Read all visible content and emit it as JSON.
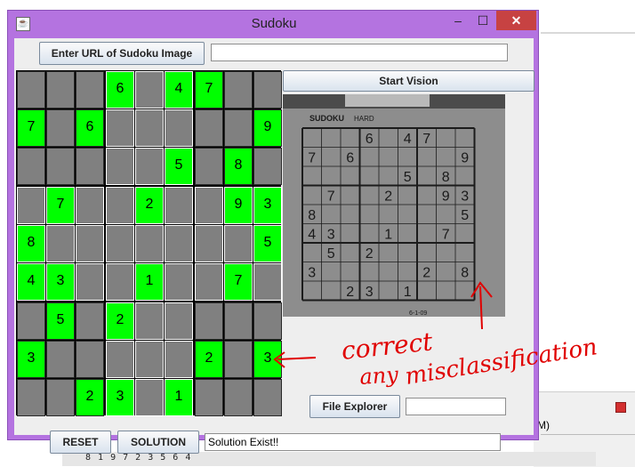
{
  "window": {
    "title": "Sudoku",
    "minimize": "–",
    "maximize": "☐",
    "close": "✕"
  },
  "toolbar": {
    "url_button": "Enter URL of Sudoku Image",
    "url_value": "",
    "start_vision": "Start Vision",
    "file_explorer": "File Explorer",
    "file_path": ""
  },
  "bottom": {
    "reset": "RESET",
    "solution": "SOLUTION",
    "status": "Solution Exist!!"
  },
  "grid": [
    [
      "",
      "",
      "",
      "6",
      "",
      "4",
      "7",
      "",
      ""
    ],
    [
      "7",
      "",
      "6",
      "",
      "",
      "",
      "",
      "",
      "9"
    ],
    [
      "",
      "",
      "",
      "",
      "",
      "5",
      "",
      "8",
      ""
    ],
    [
      "",
      "7",
      "",
      "",
      "2",
      "",
      "",
      "9",
      "3"
    ],
    [
      "8",
      "",
      "",
      "",
      "",
      "",
      "",
      "",
      "5"
    ],
    [
      "4",
      "3",
      "",
      "",
      "1",
      "",
      "",
      "7",
      ""
    ],
    [
      "",
      "5",
      "",
      "2",
      "",
      "",
      "",
      "",
      ""
    ],
    [
      "3",
      "",
      "",
      "",
      "",
      "",
      "2",
      "",
      "3"
    ],
    [
      "",
      "",
      "2",
      "3",
      "",
      "1",
      "",
      "",
      ""
    ]
  ],
  "photo": {
    "header": "SUDOKU",
    "level": "HARD",
    "digits": [
      [
        "",
        "",
        "",
        "6",
        "",
        "4",
        "7",
        "",
        ""
      ],
      [
        "7",
        "",
        "6",
        "",
        "",
        "",
        "",
        "",
        "9"
      ],
      [
        "",
        "",
        "",
        "",
        "",
        "5",
        "",
        "8",
        ""
      ],
      [
        "",
        "7",
        "",
        "",
        "2",
        "",
        "",
        "9",
        "3"
      ],
      [
        "8",
        "",
        "",
        "",
        "",
        "",
        "",
        "",
        "5"
      ],
      [
        "4",
        "3",
        "",
        "",
        "1",
        "",
        "",
        "7",
        ""
      ],
      [
        "",
        "5",
        "",
        "2",
        "",
        "",
        "",
        "",
        ""
      ],
      [
        "3",
        "",
        "",
        "",
        "",
        "",
        "2",
        "",
        "8"
      ],
      [
        "",
        "",
        "2",
        "3",
        "",
        "1",
        "",
        "",
        ""
      ]
    ],
    "footer": "6-1-09"
  },
  "annotation": {
    "line1": "correct",
    "line2": "any",
    "line3": "misclassification",
    "color": "#e00000"
  },
  "background": {
    "bottom_text": "8 1 9 7 2 3 5 6 4",
    "side_text": "M)"
  }
}
